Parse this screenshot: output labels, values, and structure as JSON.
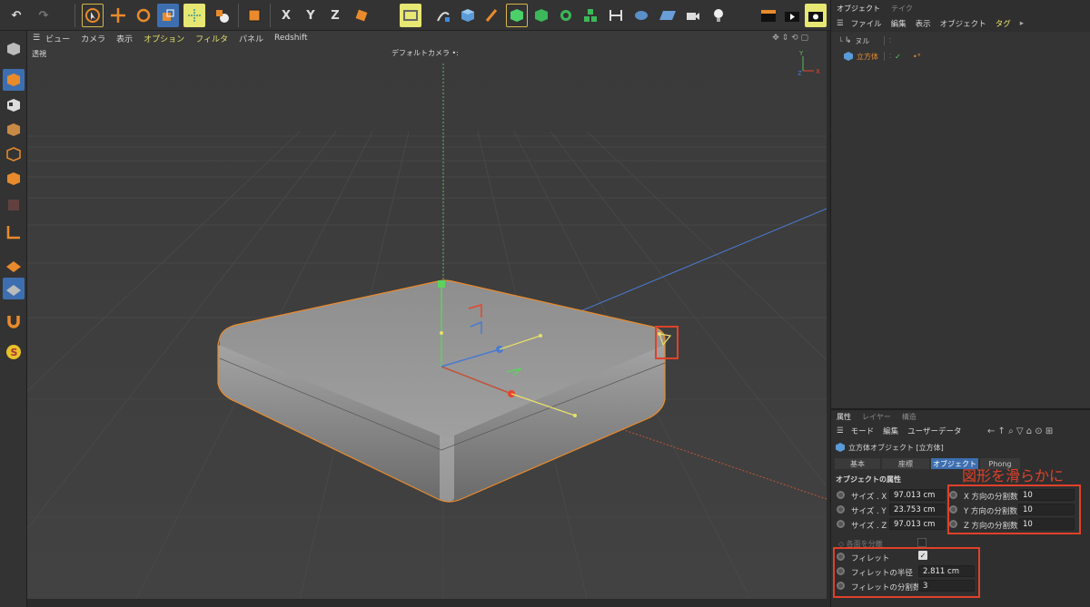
{
  "toolbar": {
    "x_axis": "X",
    "y_axis": "Y",
    "z_axis": "Z"
  },
  "viewport_menu": {
    "items": [
      "ビュー",
      "カメラ",
      "表示",
      "オプション",
      "フィルタ",
      "パネル",
      "Redshift"
    ],
    "highlighted": [
      "オプション",
      "フィルタ"
    ]
  },
  "viewport": {
    "view_name": "透視",
    "camera_label": "デフォルトカメラ"
  },
  "object_manager": {
    "tabs": [
      "オブジェクト",
      "テイク"
    ],
    "menu": [
      "ファイル",
      "編集",
      "表示",
      "オブジェクト",
      "タグ"
    ],
    "objects": [
      {
        "name": "ヌル"
      },
      {
        "name": "立方体"
      }
    ]
  },
  "attribute_manager": {
    "tabs": [
      "属性",
      "レイヤー",
      "構造"
    ],
    "menu": [
      "モード",
      "編集",
      "ユーザーデータ"
    ],
    "object_title": "立方体オブジェクト [立方体]",
    "subtabs": [
      "基本",
      "座標",
      "オブジェクト",
      "Phong"
    ],
    "section_title": "オブジェクトの属性",
    "size": [
      {
        "label": "サイズ . X",
        "value": "97.013 cm"
      },
      {
        "label": "サイズ . Y",
        "value": "23.753 cm"
      },
      {
        "label": "サイズ . Z",
        "value": "97.013 cm"
      }
    ],
    "segments": [
      {
        "label": "X 方向の分割数",
        "value": "10"
      },
      {
        "label": "Y 方向の分割数",
        "value": "10"
      },
      {
        "label": "Z 方向の分割数",
        "value": "10"
      }
    ],
    "separate_surfaces_label": "各面を分離",
    "fillet_label": "フィレット",
    "fillet_radius_label": "フィレットの半径",
    "fillet_radius_value": "2.811 cm",
    "fillet_subdiv_label": "フィレットの分割数",
    "fillet_subdiv_value": "3"
  },
  "annotation": {
    "text": "図形を滑らかに",
    "color": "#e0412a"
  },
  "colors": {
    "accent_yellow": "#e4e06a",
    "selection_orange": "#e98b2c",
    "annotation_red": "#e0412a"
  }
}
